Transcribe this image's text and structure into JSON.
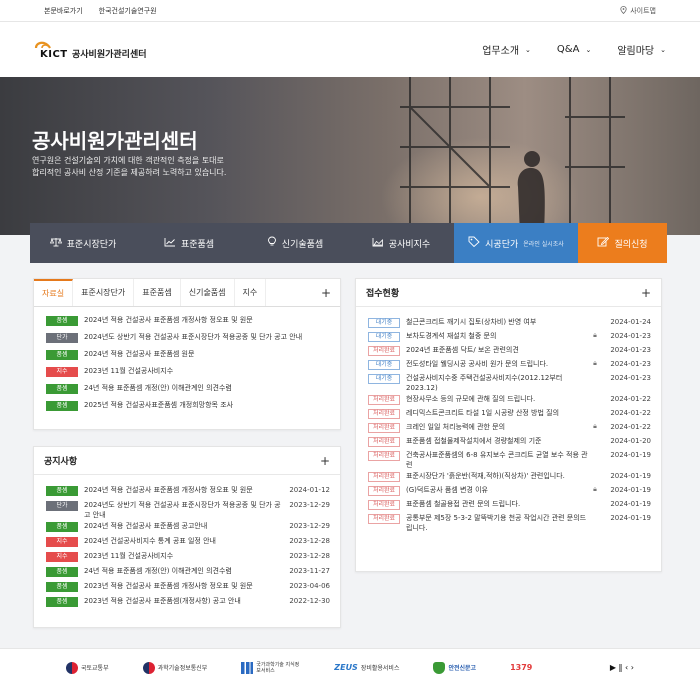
{
  "topbar": {
    "links": [
      "본문바로가기",
      "한국건설기술연구원"
    ],
    "sitemap": "사이트맵"
  },
  "header": {
    "logo_text": "KICT",
    "center_name": "공사비원가관리센터",
    "menu": [
      "업무소개",
      "Q&A",
      "알림마당"
    ]
  },
  "hero": {
    "title": "공사비원가관리센터",
    "desc_line1": "연구원은 건설기술의 가치에 대한 객관적인 측정을 토대로",
    "desc_line2": "합리적인 공사비 산정 기준을 제공하려 노력하고 있습니다."
  },
  "quick_nav": {
    "items": [
      "표준시장단가",
      "표준품셈",
      "신기술품셈",
      "공사비지수"
    ],
    "blue_label": "시공단가",
    "blue_sub": "온라인 실시조사",
    "orange_label": "질의신청"
  },
  "data_panel": {
    "tabs": [
      "자료실",
      "표준시장단가",
      "표준품셈",
      "신기술품셈",
      "지수"
    ],
    "active_tab": "자료실",
    "rows": [
      {
        "badge": "품셈",
        "type": "green",
        "text": "2024년 적용 건설공사 표준품셈 개정사항 정오표 및 원문"
      },
      {
        "badge": "단가",
        "type": "gray",
        "text": "2024년도 상반기 적용 건설공사 표준시장단가 적용공종 및 단가 공고 안내"
      },
      {
        "badge": "품셈",
        "type": "green",
        "text": "2024년 적용 건설공사 표준품셈 원문"
      },
      {
        "badge": "지수",
        "type": "red",
        "text": "2023년 11월 건설공사비지수"
      },
      {
        "badge": "품셈",
        "type": "green",
        "text": "24년 적용 표준품셈 개정(안) 이해관계인 의견수렴"
      },
      {
        "badge": "품셈",
        "type": "green",
        "text": "2025년 적용 건설공사표준품셈 개정희망항목 조사"
      }
    ]
  },
  "notice_panel": {
    "title": "공지사항",
    "rows": [
      {
        "badge": "품셈",
        "type": "green",
        "text": "2024년 적용 건설공사 표준품셈 개정사항 정오표 및 원문",
        "date": "2024-01-12"
      },
      {
        "badge": "단가",
        "type": "gray",
        "text": "2024년도 상반기 적용 건설공사 표준시장단가 적용공종 및 단가 공고 안내",
        "date": "2023-12-29"
      },
      {
        "badge": "품셈",
        "type": "green",
        "text": "2024년 적용 건설공사 표준품셈 공고안내",
        "date": "2023-12-29"
      },
      {
        "badge": "지수",
        "type": "red",
        "text": "2024년 건설공사비지수 통계 공표 일정 안내",
        "date": "2023-12-28"
      },
      {
        "badge": "지수",
        "type": "red",
        "text": "2023년 11월 건설공사비지수",
        "date": "2023-12-28"
      },
      {
        "badge": "품셈",
        "type": "green",
        "text": "24년 적용 표준품셈 개정(안) 이해관계인 의견수렴",
        "date": "2023-11-27"
      },
      {
        "badge": "품셈",
        "type": "green",
        "text": "2023년 적용 건설공사 표준품셈 개정사항 정오표 및 원문",
        "date": "2023-04-06"
      },
      {
        "badge": "품셈",
        "type": "green",
        "text": "2023년 적용 건설공사 표준품셈(개정사항) 공고 안내",
        "date": "2022-12-30"
      }
    ]
  },
  "receive_panel": {
    "title": "접수현황",
    "rows": [
      {
        "status": "대기중",
        "type": "wait",
        "text": "철근콘크리트 깨기시 집토(상차비) 반영 여부",
        "lock": false,
        "date": "2024-01-24"
      },
      {
        "status": "대기중",
        "type": "wait",
        "text": "보차도경계석 재설치 철중 문의",
        "lock": true,
        "date": "2024-01-23"
      },
      {
        "status": "처리완료",
        "type": "done",
        "text": "2024년 표준품셈 닥트/ 보온 관련의견",
        "lock": false,
        "date": "2024-01-23"
      },
      {
        "status": "대기중",
        "type": "wait",
        "text": "전도성타일 웰딩시공 공사비 원가 문의 드립니다.",
        "lock": true,
        "date": "2024-01-23"
      },
      {
        "status": "대기중",
        "type": "wait",
        "text": "건설공사비지수중 주택건설공사비지수(2012.12부터 2023.12)",
        "lock": false,
        "date": "2024-01-23"
      },
      {
        "status": "처리완료",
        "type": "done",
        "text": "현장사무소 등의 규모에 관해 질의 드립니다.",
        "lock": false,
        "date": "2024-01-22"
      },
      {
        "status": "처리완료",
        "type": "done",
        "text": "레디믹스트콘크리트 타설 1일 시공량 산정 방법 질의",
        "lock": false,
        "date": "2024-01-22"
      },
      {
        "status": "처리완료",
        "type": "done",
        "text": "크레인 일일 처리능력에 관한 문의",
        "lock": true,
        "date": "2024-01-22"
      },
      {
        "status": "처리완료",
        "type": "done",
        "text": "표준품셈 접철물제작설치에서 경량철제의 기준",
        "lock": false,
        "date": "2024-01-20"
      },
      {
        "status": "처리완료",
        "type": "done",
        "text": "건축공사표준품셈의 6-8 유지보수 콘크리트 균열 보수 적용 관련",
        "lock": false,
        "date": "2024-01-19"
      },
      {
        "status": "처리완료",
        "type": "done",
        "text": "표준시장단가 '흙운반(적재,적하)(직상차)' 관련입니다.",
        "lock": false,
        "date": "2024-01-19"
      },
      {
        "status": "처리완료",
        "type": "done",
        "text": "(G)덕트공사 품셈 변경 이유",
        "lock": true,
        "date": "2024-01-19"
      },
      {
        "status": "처리완료",
        "type": "done",
        "text": "표준품셈 철골용접 관련 문의 드립니다.",
        "lock": false,
        "date": "2024-01-19"
      },
      {
        "status": "처리완료",
        "type": "done",
        "text": "공통부문 제5장 5-3-2 말뚝박기용 천공 작업시간 관련 문의드립니다.",
        "lock": false,
        "date": "2024-01-19"
      }
    ]
  },
  "footer": {
    "links": [
      "국토교통부",
      "과학기술정보통신부",
      "국가과학기술 지식정보서비스",
      "장비활용서비스",
      "안전신문고"
    ],
    "zeus": "ZEUS",
    "phone": "1379",
    "controls": "▶ ‖ ‹ ›"
  },
  "colors": {
    "accent": "#e5791c",
    "blue": "#3b7fc4",
    "orange": "#ec7d1d",
    "dark_nav": "#4a4e5b"
  }
}
